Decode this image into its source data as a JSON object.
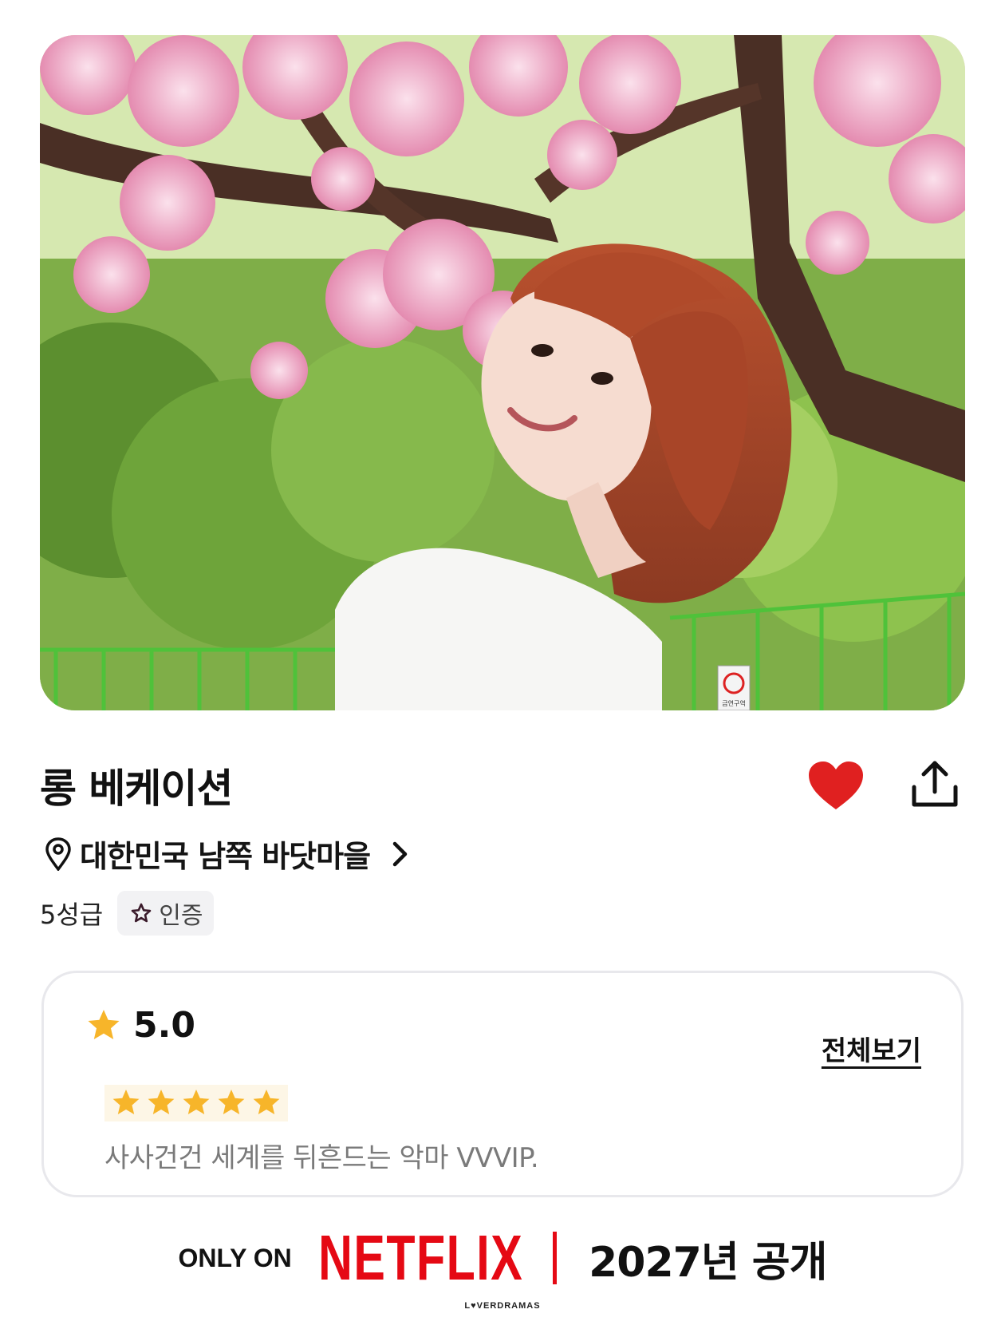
{
  "hero": {
    "image_label": "photo",
    "sign_text": "금연구역"
  },
  "listing": {
    "title": "롱 베케이션",
    "location": "대한민국 남쪽 바닷마을",
    "grade": "5성급",
    "certified_label": "인증",
    "favorited": true
  },
  "review": {
    "score": "5.0",
    "view_all_label": "전체보기",
    "stars": 5,
    "text": "사사건건 세계를 뒤흔드는 악마 VVVIP."
  },
  "footer": {
    "only_on": "ONLY ON",
    "brand": "NETFLIX",
    "release": "2027년 공개"
  },
  "watermark": "L♥VERDRAMAS",
  "colors": {
    "accent_red": "#e50914",
    "heart_red": "#e02020",
    "star_gold": "#f7b52a"
  }
}
